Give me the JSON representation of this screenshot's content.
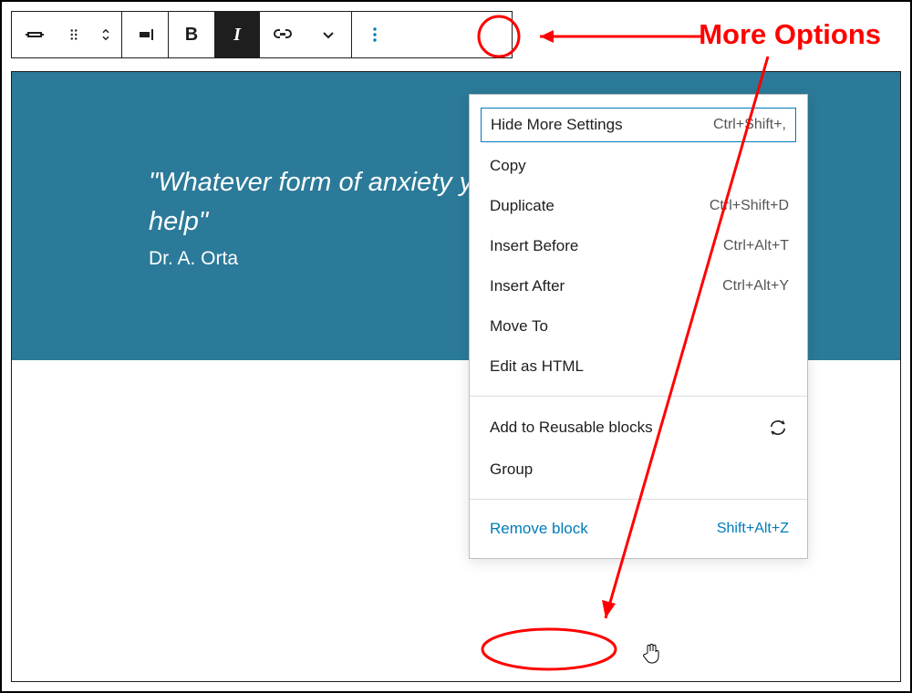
{
  "annotation": {
    "label": "More Options"
  },
  "cover": {
    "quote": "\"Whatever form of anxiety you have, treatment can help\"",
    "citation": "Dr. A. Orta",
    "bg_color": "#2b7a99"
  },
  "menu": {
    "sections": [
      [
        {
          "label": "Hide More Settings",
          "shortcut": "Ctrl+Shift+,",
          "highlight": true
        },
        {
          "label": "Copy"
        },
        {
          "label": "Duplicate",
          "shortcut": "Ctrl+Shift+D"
        },
        {
          "label": "Insert Before",
          "shortcut": "Ctrl+Alt+T"
        },
        {
          "label": "Insert After",
          "shortcut": "Ctrl+Alt+Y"
        },
        {
          "label": "Move To"
        },
        {
          "label": "Edit as HTML"
        }
      ],
      [
        {
          "label": "Add to Reusable blocks",
          "icon": "sync"
        },
        {
          "label": "Group"
        }
      ],
      [
        {
          "label": "Remove block",
          "shortcut": "Shift+Alt+Z",
          "remove": true
        }
      ]
    ]
  }
}
